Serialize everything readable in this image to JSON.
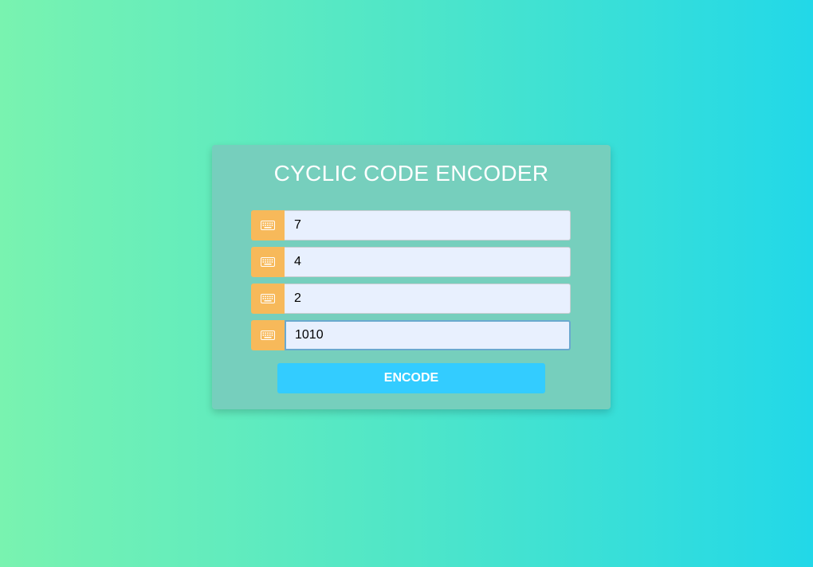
{
  "form": {
    "title": "CYCLIC CODE ENCODER",
    "fields": [
      {
        "icon": "keyboard-icon",
        "value": "7"
      },
      {
        "icon": "keyboard-icon",
        "value": "4"
      },
      {
        "icon": "keyboard-icon",
        "value": "2"
      },
      {
        "icon": "keyboard-icon",
        "value": "1010"
      }
    ],
    "encode_label": "ENCODE"
  },
  "colors": {
    "background_gradient_start": "#79f3b0",
    "background_gradient_end": "#22d8e8",
    "card": "#76cfbd",
    "icon_bg": "#f7b95a",
    "input_bg": "#e8f0fe",
    "button": "#33ccff",
    "focus_border": "#6aa9cf"
  }
}
